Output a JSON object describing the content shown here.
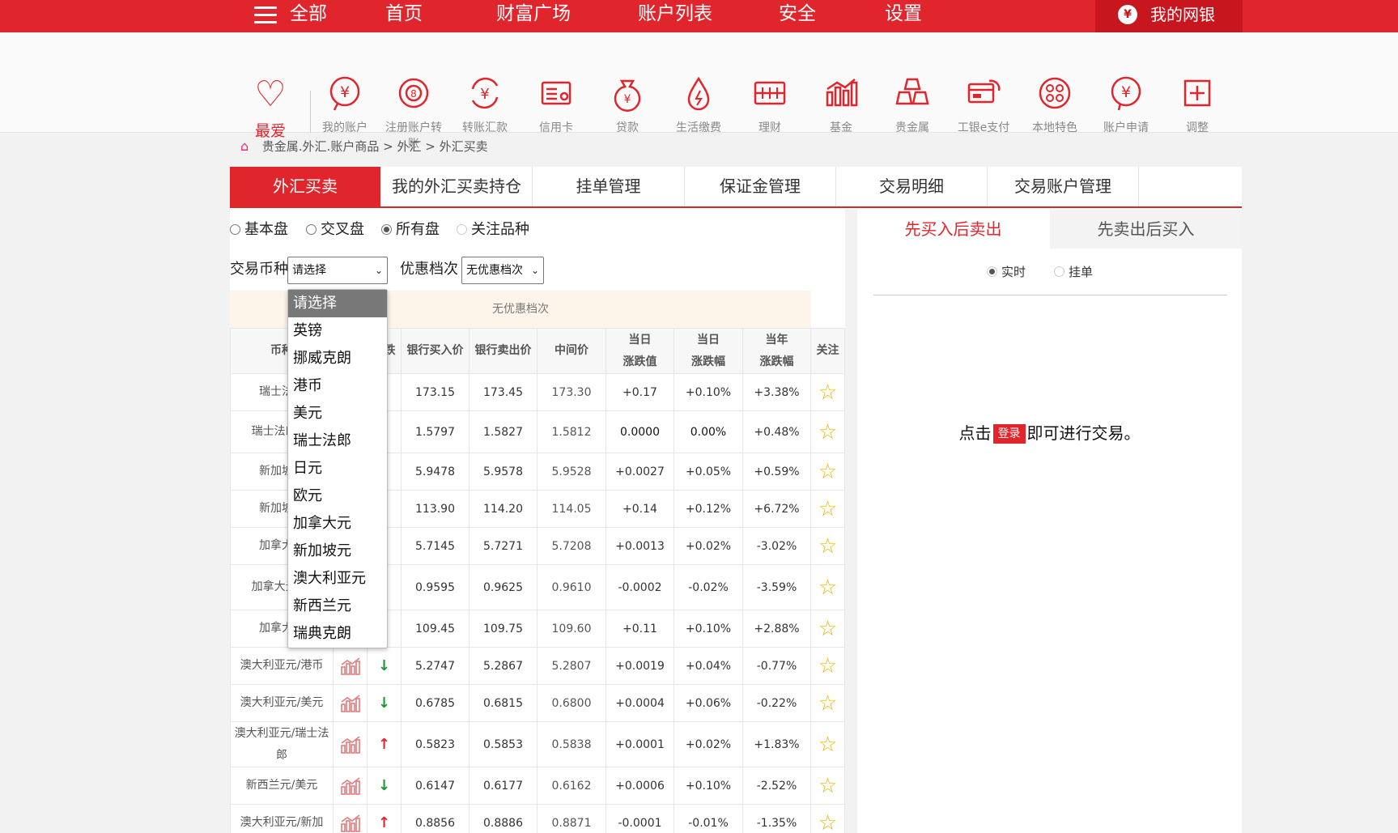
{
  "topnav": {
    "all": "全部",
    "items": [
      "首页",
      "财富广场",
      "账户列表",
      "安全",
      "设置"
    ],
    "mybank": "我的网银"
  },
  "iconbar": {
    "favorite": "最爱",
    "apps": [
      {
        "label": "我的账户",
        "icon": "yen-coin-icon"
      },
      {
        "label": "注册账户转账",
        "icon": "transfer-coin-icon"
      },
      {
        "label": "转账汇款",
        "icon": "remit-icon"
      },
      {
        "label": "信用卡",
        "icon": "credit-card-icon"
      },
      {
        "label": "贷款",
        "icon": "money-bag-icon"
      },
      {
        "label": "生活缴费",
        "icon": "utility-drop-icon"
      },
      {
        "label": "理财",
        "icon": "finance-box-icon"
      },
      {
        "label": "基金",
        "icon": "fund-chart-icon"
      },
      {
        "label": "贵金属",
        "icon": "gold-bars-icon"
      },
      {
        "label": "工银e支付",
        "icon": "e-pay-icon"
      },
      {
        "label": "本地特色",
        "icon": "local-feature-icon"
      },
      {
        "label": "账户申请",
        "icon": "account-apply-icon"
      },
      {
        "label": "调整",
        "icon": "plus-square-icon"
      }
    ]
  },
  "breadcrumb": {
    "p1": "贵金属.外汇.账户商品",
    "p2": "外汇",
    "p3": "外汇买卖",
    "sep": ">"
  },
  "tabs": [
    "外汇买卖",
    "我的外汇买卖持仓",
    "挂单管理",
    "保证金管理",
    "交易明细",
    "交易账户管理"
  ],
  "radios": [
    "基本盘",
    "交叉盘",
    "所有盘",
    "关注品种"
  ],
  "filters": {
    "currency_label": "交易币种",
    "currency_value": "请选择",
    "discount_label": "优惠档次",
    "discount_value": "无优惠档次"
  },
  "discount_band": "无优惠档次",
  "dropdown": {
    "options": [
      "请选择",
      "英镑",
      "挪威克朗",
      "港币",
      "美元",
      "瑞士法郎",
      "日元",
      "欧元",
      "加拿大元",
      "新加坡元",
      "澳大利亚元",
      "新西兰元",
      "瑞典克朗"
    ],
    "selected": "请选择"
  },
  "table": {
    "headers": {
      "currency": "币种",
      "trend": "",
      "change": "涨跌",
      "bank_buy": "银行买入价",
      "bank_sell": "银行卖出价",
      "mid": "中间价",
      "day_change_1": "当日",
      "day_change_2": "涨跌值",
      "day_pct_1": "当日",
      "day_pct_2": "涨跌幅",
      "year_pct_1": "当年",
      "year_pct_2": "涨跌幅",
      "follow": "关注"
    },
    "rows": [
      {
        "name": "瑞士法郎",
        "dir": "down",
        "buy": "173.15",
        "sell": "173.45",
        "mid": "173.30",
        "dv": "+0.17",
        "dp": "+0.10%",
        "yp": "+3.38%"
      },
      {
        "name": "瑞士法郎/元",
        "dir": "up",
        "buy": "1.5797",
        "sell": "1.5827",
        "mid": "1.5812",
        "dv": "0.0000",
        "dp": "0.00%",
        "yp": "+0.48%"
      },
      {
        "name": "新加坡元",
        "dir": "down",
        "buy": "5.9478",
        "sell": "5.9578",
        "mid": "5.9528",
        "dv": "+0.0027",
        "dp": "+0.05%",
        "yp": "+0.59%"
      },
      {
        "name": "新加坡元",
        "dir": "down",
        "buy": "113.90",
        "sell": "114.20",
        "mid": "114.05",
        "dv": "+0.14",
        "dp": "+0.12%",
        "yp": "+6.72%"
      },
      {
        "name": "加拿大元",
        "dir": "up",
        "buy": "5.7145",
        "sell": "5.7271",
        "mid": "5.7208",
        "dv": "+0.0013",
        "dp": "+0.02%",
        "yp": "-3.02%"
      },
      {
        "name": "加拿大元/元",
        "dir": "up",
        "buy": "0.9595",
        "sell": "0.9625",
        "mid": "0.9610",
        "dv": "-0.0002",
        "dp": "-0.02%",
        "yp": "-3.59%"
      },
      {
        "name": "加拿大元",
        "dir": "down",
        "buy": "109.45",
        "sell": "109.75",
        "mid": "109.60",
        "dv": "+0.11",
        "dp": "+0.10%",
        "yp": "+2.88%"
      },
      {
        "name": "澳大利亚元/港币",
        "dir": "down",
        "buy": "5.2747",
        "sell": "5.2867",
        "mid": "5.2807",
        "dv": "+0.0019",
        "dp": "+0.04%",
        "yp": "-0.77%"
      },
      {
        "name": "澳大利亚元/美元",
        "dir": "down",
        "buy": "0.6785",
        "sell": "0.6815",
        "mid": "0.6800",
        "dv": "+0.0004",
        "dp": "+0.06%",
        "yp": "-0.22%"
      },
      {
        "name": "澳大利亚元/瑞士法郎",
        "dir": "up",
        "buy": "0.5823",
        "sell": "0.5853",
        "mid": "0.5838",
        "dv": "+0.0001",
        "dp": "+0.02%",
        "yp": "+1.83%"
      },
      {
        "name": "新西兰元/美元",
        "dir": "down",
        "buy": "0.6147",
        "sell": "0.6177",
        "mid": "0.6162",
        "dv": "+0.0006",
        "dp": "+0.10%",
        "yp": "-2.52%"
      },
      {
        "name": "澳大利亚元/新加",
        "dir": "up",
        "buy": "0.8856",
        "sell": "0.8886",
        "mid": "0.8871",
        "dv": "-0.0001",
        "dp": "-0.01%",
        "yp": "-1.35%"
      }
    ]
  },
  "right": {
    "tabs": [
      "先买入后卖出",
      "先卖出后买入"
    ],
    "radios": [
      "实时",
      "挂单"
    ],
    "msg_before": "点击",
    "login_btn": "登录",
    "msg_after": "即可进行交易。"
  },
  "colors": {
    "brand_red": "#e0252c",
    "up": "#e0252c",
    "down": "#1b9a33",
    "star": "#f0b400"
  }
}
